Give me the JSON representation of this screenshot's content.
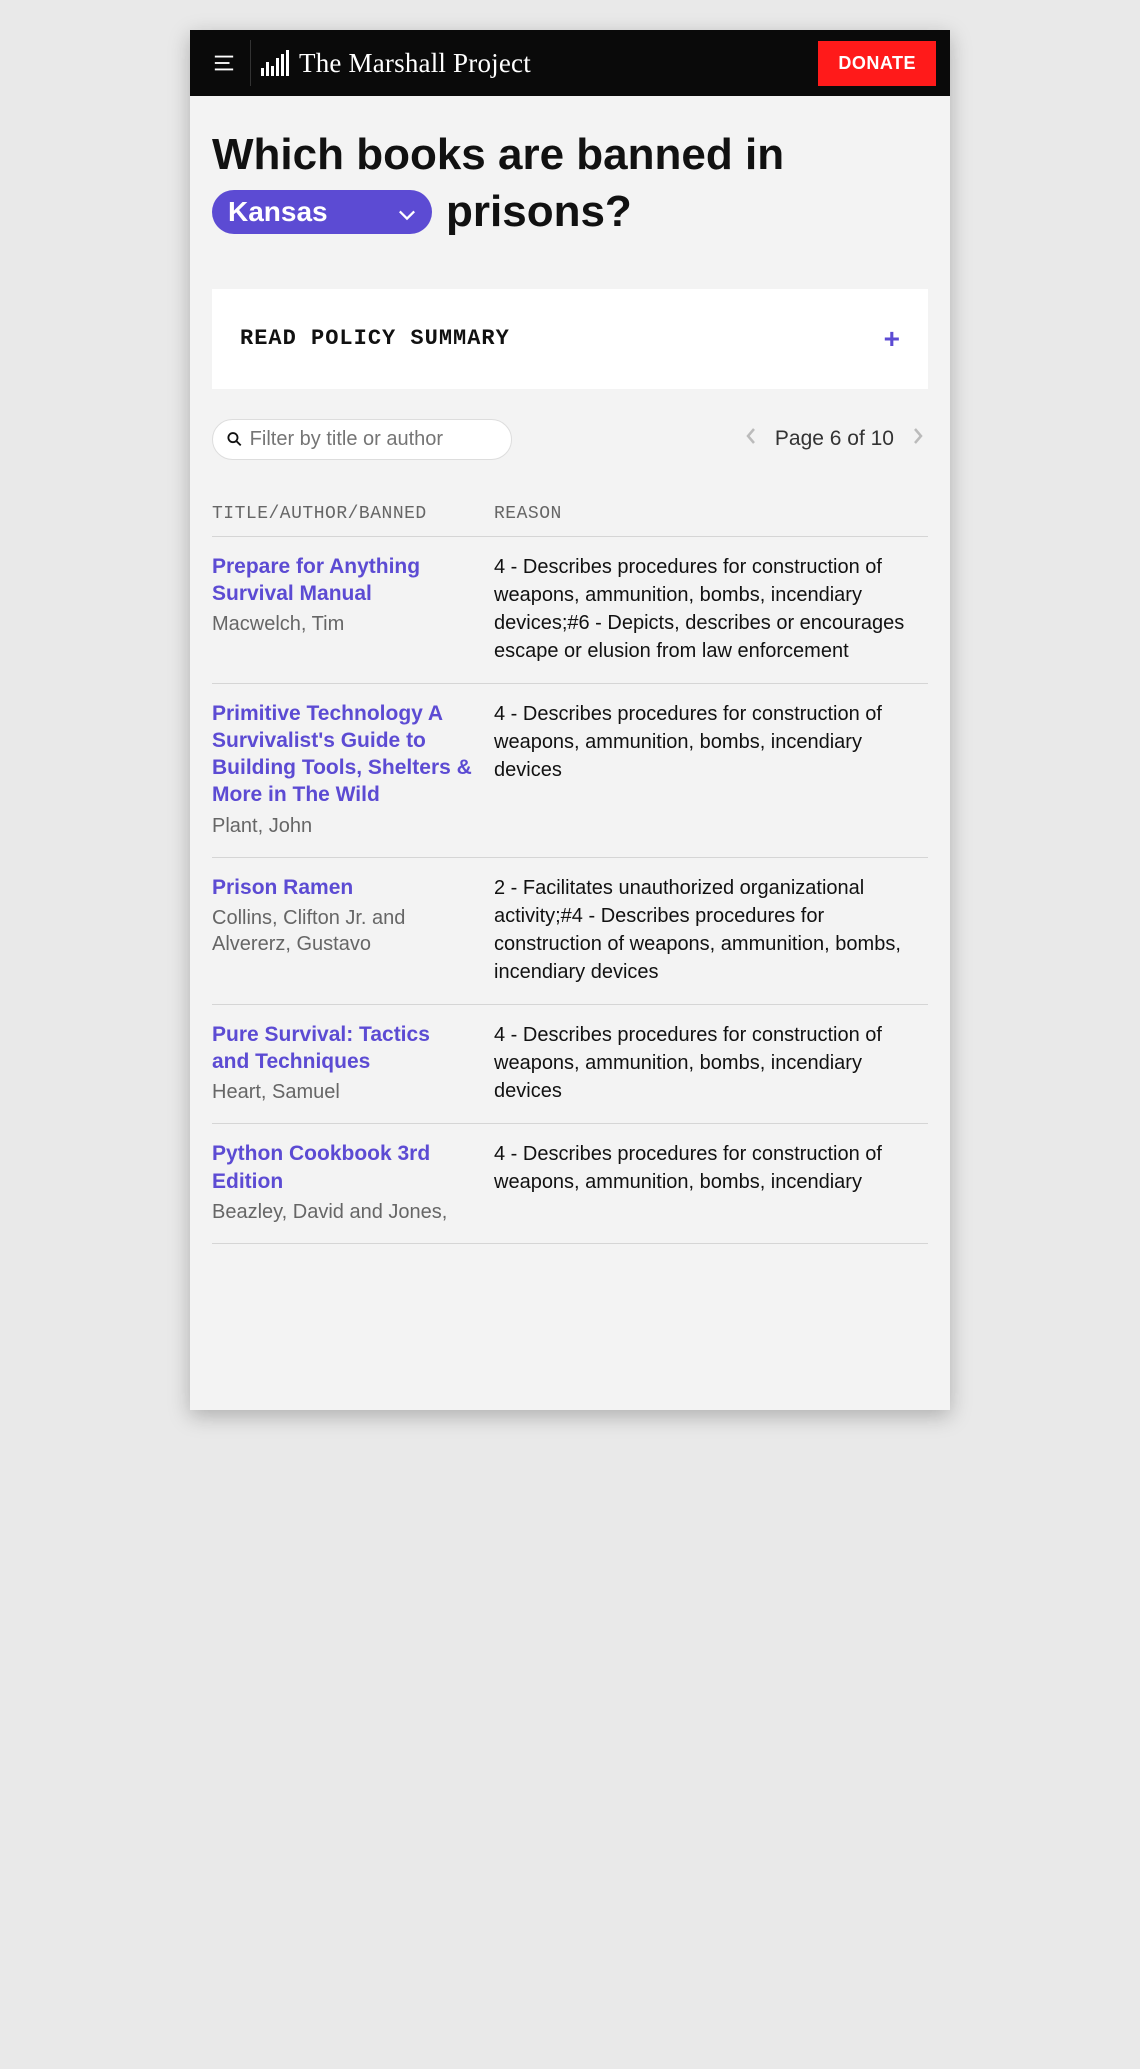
{
  "header": {
    "brand": "The Marshall Project",
    "donate_label": "DONATE"
  },
  "headline": {
    "prefix": "Which books are banned in",
    "state": "Kansas",
    "suffix": "prisons?"
  },
  "policy": {
    "label": "READ POLICY SUMMARY"
  },
  "search": {
    "placeholder": "Filter by title or author"
  },
  "pager": {
    "label": "Page 6 of 10",
    "current": 6,
    "total": 10
  },
  "table": {
    "header_left": "TITLE/AUTHOR/BANNED",
    "header_right": "REASON",
    "rows": [
      {
        "title": "Prepare for Anything Survival Manual",
        "author": "Macwelch, Tim",
        "reason": "4 - Describes procedures for construction of weapons, ammunition, bombs, incendiary devices;#6 - Depicts, describes or encourages escape or elusion from law enforcement"
      },
      {
        "title": "Primitive Technology A Survivalist's Guide to Building Tools, Shelters & More in The Wild",
        "author": "Plant, John",
        "reason": "4 - Describes procedures for construction of weapons, ammunition, bombs, incendiary devices"
      },
      {
        "title": "Prison Ramen",
        "author": "Collins, Clifton Jr. and Alvererz, Gustavo",
        "reason": "2 - Facilitates unauthorized organizational activity;#4 - Describes procedures for construction of weapons, ammunition, bombs, incendiary devices"
      },
      {
        "title": "Pure Survival: Tactics and Techniques",
        "author": "Heart, Samuel",
        "reason": "4 - Describes procedures for construction of weapons, ammunition, bombs, incendiary devices"
      },
      {
        "title": "Python Cookbook 3rd Edition",
        "author": "Beazley, David and Jones,",
        "reason": "4 - Describes procedures for construction of weapons, ammunition, bombs, incendiary"
      }
    ]
  }
}
